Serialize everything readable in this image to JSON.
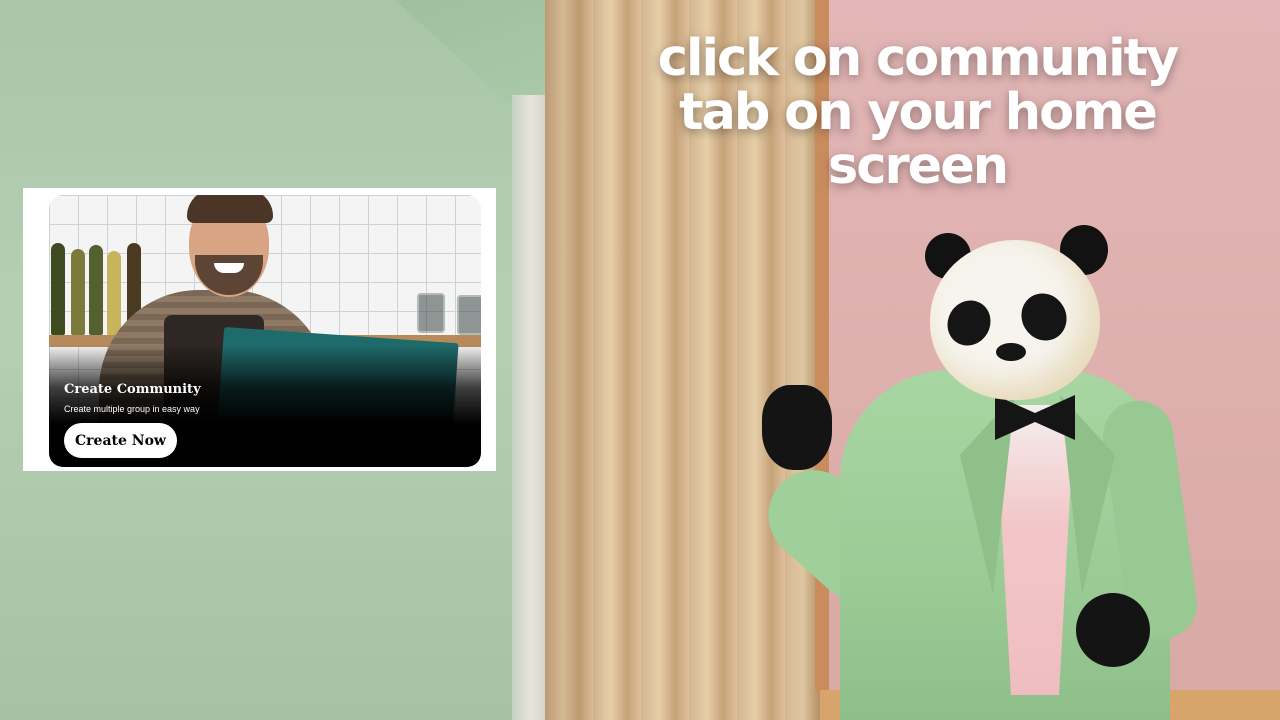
{
  "caption": {
    "text": "click on community tab on your home screen",
    "color": "#ffffff"
  },
  "card": {
    "title": "Create Community",
    "subtitle": "Create multiple group in easy way",
    "button_label": "Create Now",
    "button_color": "#ffffff",
    "overlay_color": "#000000"
  },
  "icons": {
    "character": "panda-in-green-suit-illustration",
    "card_photo": "smiling-shopkeeper-photo"
  }
}
